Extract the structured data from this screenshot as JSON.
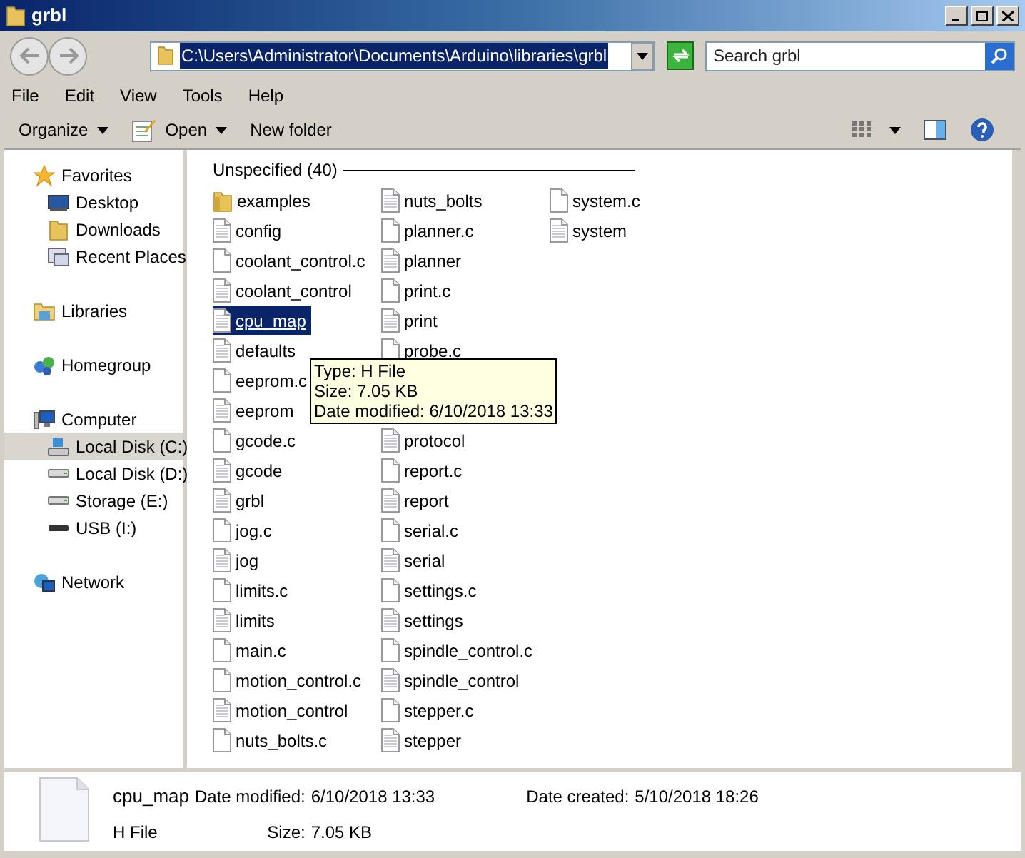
{
  "window": {
    "title": "grbl"
  },
  "address": {
    "path": "C:\\Users\\Administrator\\Documents\\Arduino\\libraries\\grbl"
  },
  "search": {
    "placeholder": "Search grbl"
  },
  "menu": [
    "File",
    "Edit",
    "View",
    "Tools",
    "Help"
  ],
  "toolbar": [
    {
      "label": "Organize",
      "kind": "dropdown"
    },
    {
      "label": "Open",
      "kind": "open"
    },
    {
      "label": "New folder",
      "kind": "plain"
    }
  ],
  "sidebar": {
    "groups": [
      {
        "label": "Favorites",
        "kind": "star",
        "children": [
          {
            "label": "Desktop",
            "kind": "desktop",
            "selected": false
          },
          {
            "label": "Downloads",
            "kind": "folder",
            "selected": false
          },
          {
            "label": "Recent Places",
            "kind": "recent",
            "selected": false
          }
        ]
      },
      {
        "label": "Libraries",
        "kind": "libraries"
      },
      {
        "label": "Homegroup",
        "kind": "homegroup"
      },
      {
        "label": "Computer",
        "kind": "computer",
        "children": [
          {
            "label": "Local Disk (C:)",
            "kind": "sysdisk",
            "selected": true
          },
          {
            "label": "Local Disk (D:)",
            "kind": "disk",
            "selected": false
          },
          {
            "label": "Storage (E:)",
            "kind": "disk",
            "selected": false
          },
          {
            "label": "USB (I:)",
            "kind": "usb",
            "selected": false
          }
        ]
      },
      {
        "label": "Network",
        "kind": "network"
      }
    ]
  },
  "group_header": "Unspecified (40)",
  "columns": [
    [
      {
        "name": "examples",
        "kind": "folder",
        "selected": false
      },
      {
        "name": "config",
        "kind": "header",
        "selected": false
      },
      {
        "name": "coolant_control.c",
        "kind": "source",
        "selected": false
      },
      {
        "name": "coolant_control",
        "kind": "header",
        "selected": false
      },
      {
        "name": "cpu_map",
        "kind": "header",
        "selected": true
      },
      {
        "name": "defaults",
        "kind": "header",
        "selected": false
      },
      {
        "name": "eeprom.c",
        "kind": "source",
        "selected": false
      },
      {
        "name": "eeprom",
        "kind": "header",
        "selected": false
      },
      {
        "name": "gcode.c",
        "kind": "source",
        "selected": false
      },
      {
        "name": "gcode",
        "kind": "header",
        "selected": false
      },
      {
        "name": "grbl",
        "kind": "header",
        "selected": false
      },
      {
        "name": "jog.c",
        "kind": "source",
        "selected": false
      },
      {
        "name": "jog",
        "kind": "header",
        "selected": false
      },
      {
        "name": "limits.c",
        "kind": "source",
        "selected": false
      },
      {
        "name": "limits",
        "kind": "header",
        "selected": false
      },
      {
        "name": "main.c",
        "kind": "source",
        "selected": false
      },
      {
        "name": "motion_control.c",
        "kind": "source",
        "selected": false
      },
      {
        "name": "motion_control",
        "kind": "header",
        "selected": false
      },
      {
        "name": "nuts_bolts.c",
        "kind": "source",
        "selected": false
      }
    ],
    [
      {
        "name": "nuts_bolts",
        "kind": "header",
        "selected": false
      },
      {
        "name": "planner.c",
        "kind": "source",
        "selected": false
      },
      {
        "name": "planner",
        "kind": "header",
        "selected": false
      },
      {
        "name": "print.c",
        "kind": "source",
        "selected": false
      },
      {
        "name": "print",
        "kind": "header",
        "selected": false
      },
      {
        "name": "probe.c",
        "kind": "source",
        "selected": false
      },
      {
        "kind": "covered"
      },
      {
        "kind": "covered"
      },
      {
        "name": "protocol",
        "kind": "header",
        "selected": false
      },
      {
        "name": "report.c",
        "kind": "source",
        "selected": false
      },
      {
        "name": "report",
        "kind": "header",
        "selected": false
      },
      {
        "name": "serial.c",
        "kind": "source",
        "selected": false
      },
      {
        "name": "serial",
        "kind": "header",
        "selected": false
      },
      {
        "name": "settings.c",
        "kind": "source",
        "selected": false
      },
      {
        "name": "settings",
        "kind": "header",
        "selected": false
      },
      {
        "name": "spindle_control.c",
        "kind": "source",
        "selected": false
      },
      {
        "name": "spindle_control",
        "kind": "header",
        "selected": false
      },
      {
        "name": "stepper.c",
        "kind": "source",
        "selected": false
      },
      {
        "name": "stepper",
        "kind": "header",
        "selected": false
      }
    ],
    [
      {
        "name": "system.c",
        "kind": "source",
        "selected": false
      },
      {
        "name": "system",
        "kind": "header",
        "selected": false
      }
    ]
  ],
  "tooltip": [
    "Type: H File",
    "Size: 7.05 KB",
    "Date modified: 6/10/2018 13:33"
  ],
  "details": {
    "name": "cpu_map",
    "type": "H File",
    "fields": [
      {
        "label": "Date modified:",
        "value": "6/10/2018 13:33"
      },
      {
        "label": "Date created:",
        "value": "5/10/2018 18:26"
      },
      {
        "label": "Size:",
        "value": "7.05 KB"
      }
    ]
  }
}
